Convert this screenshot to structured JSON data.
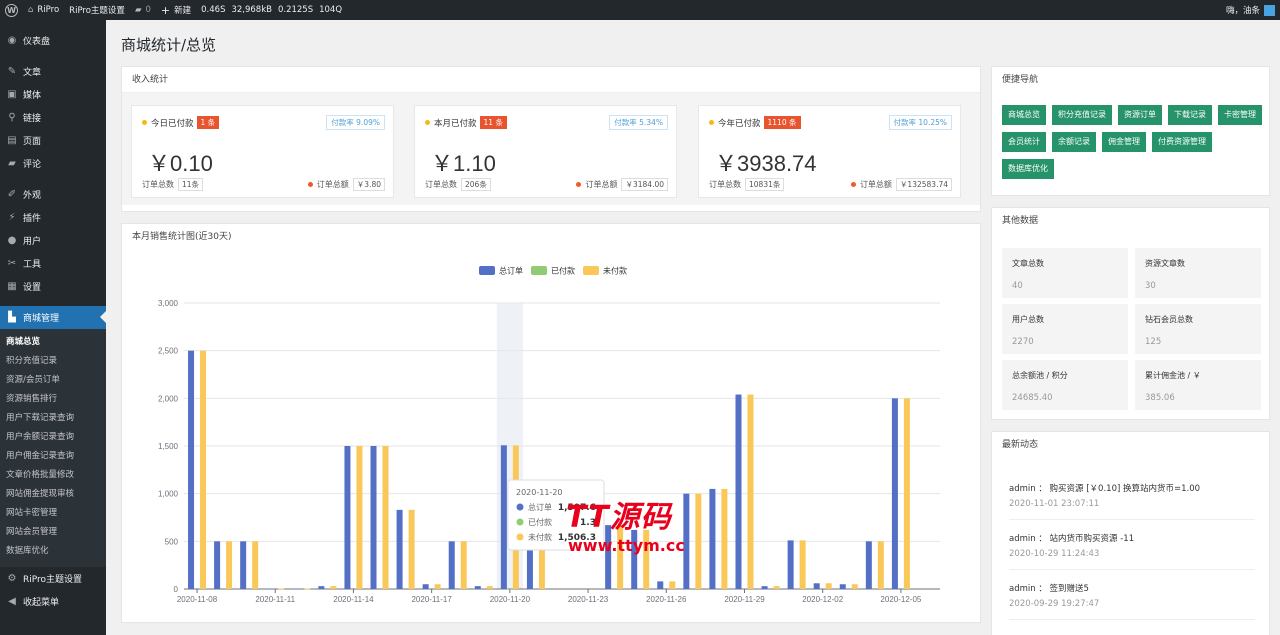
{
  "adminbar": {
    "site": "RiPro",
    "theme_settings": "RiPro主题设置",
    "comments": "0",
    "new": "新建",
    "stats": [
      "0.46S",
      "32,968kB",
      "0.2125S",
      "104Q"
    ],
    "greeting": "嗨，油条"
  },
  "sidebar": {
    "items": [
      {
        "label": "仪表盘",
        "icon": "dashboard-icon",
        "glyph": "◉"
      },
      {
        "label": "文章",
        "icon": "pin-icon",
        "glyph": "✎"
      },
      {
        "label": "媒体",
        "icon": "media-icon",
        "glyph": "▣"
      },
      {
        "label": "链接",
        "icon": "link-icon",
        "glyph": "⚲"
      },
      {
        "label": "页面",
        "icon": "page-icon",
        "glyph": "▤"
      },
      {
        "label": "评论",
        "icon": "comment-icon",
        "glyph": "▰"
      },
      {
        "label": "外观",
        "icon": "brush-icon",
        "glyph": "✐"
      },
      {
        "label": "插件",
        "icon": "plugin-icon",
        "glyph": "⚡"
      },
      {
        "label": "用户",
        "icon": "user-icon",
        "glyph": "●"
      },
      {
        "label": "工具",
        "icon": "wrench-icon",
        "glyph": "✂"
      },
      {
        "label": "设置",
        "icon": "settings-icon",
        "glyph": "▦"
      },
      {
        "label": "商城管理",
        "icon": "cart-icon",
        "glyph": "🛒"
      }
    ],
    "submenu": [
      "商城总览",
      "积分充值记录",
      "资源/会员订单",
      "资源销售排行",
      "用户下载记录查询",
      "用户余额记录查询",
      "用户佣金记录查询",
      "文章价格批量修改",
      "网站佣金提现审核",
      "网站卡密管理",
      "网站会员管理",
      "数据库优化"
    ],
    "bottom": [
      {
        "label": "RiPro主题设置",
        "icon": "gear-icon",
        "glyph": "⚙"
      },
      {
        "label": "收起菜单",
        "icon": "collapse-icon",
        "glyph": "◀"
      }
    ]
  },
  "page_title": "商城统计/总览",
  "income": {
    "title": "收入统计",
    "boxes": [
      {
        "label": "今日已付款",
        "badge": "1 条",
        "rate": "付款率 9.09%",
        "amount": "￥0.10",
        "orders_label": "订单总数",
        "orders": "11条",
        "total_label": "订单总额",
        "total": "￥3.80"
      },
      {
        "label": "本月已付款",
        "badge": "11 条",
        "rate": "付款率 5.34%",
        "amount": "￥1.10",
        "orders_label": "订单总数",
        "orders": "206条",
        "total_label": "订单总额",
        "total": "￥3184.00"
      },
      {
        "label": "今年已付款",
        "badge": "1110 条",
        "rate": "付款率 10.25%",
        "amount": "￥3938.74",
        "orders_label": "订单总数",
        "orders": "10831条",
        "total_label": "订单总额",
        "total": "￥132583.74"
      }
    ]
  },
  "sales_chart": {
    "title": "本月销售统计图(近30天)",
    "tooltip": {
      "date": "2020-11-20",
      "rows": [
        {
          "name": "总订单",
          "value": "1,507.6"
        },
        {
          "name": "已付款",
          "value": "1.3"
        },
        {
          "name": "未付款",
          "value": "1,506.3"
        }
      ]
    }
  },
  "chart_data": {
    "type": "bar",
    "title": "",
    "categories": [
      "2020-11-08",
      "2020-11-09",
      "2020-11-10",
      "2020-11-11",
      "2020-11-12",
      "2020-11-13",
      "2020-11-14",
      "2020-11-15",
      "2020-11-16",
      "2020-11-17",
      "2020-11-18",
      "2020-11-19",
      "2020-11-20",
      "2020-11-21",
      "2020-11-22",
      "2020-11-23",
      "2020-11-24",
      "2020-11-25",
      "2020-11-26",
      "2020-11-27",
      "2020-11-28",
      "2020-11-29",
      "2020-11-30",
      "2020-12-01",
      "2020-12-02",
      "2020-12-03",
      "2020-12-04",
      "2020-12-05",
      "2020-12-06"
    ],
    "xticks": [
      "2020-11-08",
      "2020-11-11",
      "2020-11-14",
      "2020-11-17",
      "2020-11-20",
      "2020-11-23",
      "2020-11-26",
      "2020-11-29",
      "2020-12-02",
      "2020-12-05"
    ],
    "series": [
      {
        "name": "总订单",
        "color": "#5470c6",
        "values": [
          2500,
          500,
          500,
          5,
          5,
          30,
          1500,
          1500,
          830,
          50,
          500,
          30,
          1507.6,
          500,
          0,
          0,
          670,
          620,
          80,
          1000,
          1050,
          2040,
          30,
          510,
          60,
          50,
          500,
          2000,
          0
        ]
      },
      {
        "name": "已付款",
        "color": "#91cc75",
        "values": [
          0,
          0,
          0,
          0,
          0,
          0,
          0,
          0,
          0,
          0,
          0,
          0,
          1.3,
          0,
          0,
          0,
          0,
          0,
          0,
          0,
          0,
          0,
          0,
          0,
          0,
          0,
          0,
          0,
          0
        ]
      },
      {
        "name": "未付款",
        "color": "#fac858",
        "values": [
          2500,
          500,
          500,
          5,
          5,
          30,
          1500,
          1500,
          830,
          50,
          500,
          30,
          1506.3,
          500,
          0,
          0,
          670,
          620,
          80,
          1000,
          1050,
          2040,
          30,
          510,
          60,
          50,
          500,
          2000,
          0
        ]
      }
    ],
    "ylim": [
      0,
      3000
    ],
    "yticks": [
      "0",
      "500",
      "1,000",
      "1,500",
      "2,000",
      "2,500",
      "3,000"
    ],
    "legend": "top-center",
    "grid": true
  },
  "quick_nav": {
    "title": "便捷导航",
    "buttons": [
      "商城总览",
      "积分充值记录",
      "资源订单",
      "下载记录",
      "卡密管理",
      "会员统计",
      "余额记录",
      "佣金管理",
      "付费资源管理",
      "数据库优化"
    ]
  },
  "other_data": {
    "title": "其他数据",
    "cells": [
      {
        "label": "文章总数",
        "value": "40"
      },
      {
        "label": "资源文章数",
        "value": "30"
      },
      {
        "label": "用户总数",
        "value": "2270"
      },
      {
        "label": "钻石会员总数",
        "value": "125"
      },
      {
        "label": "总余额池 / 积分",
        "value": "24685.40"
      },
      {
        "label": "累计佣金池 / ￥",
        "value": "385.06"
      }
    ]
  },
  "activity": {
    "title": "最新动态",
    "items": [
      {
        "text": "admin ： 购买资源 [￥0.10] 换算站内货币=1.00",
        "time": "2020-11-01 23:07:11"
      },
      {
        "text": "admin ： 站内货币购买资源 -11",
        "time": "2020-10-29 11:24:43"
      },
      {
        "text": "admin ： 签到赠送5",
        "time": "2020-09-29 19:27:47"
      }
    ]
  },
  "watermark": {
    "brand": "TT源码",
    "url": "www.ttym.cc"
  }
}
